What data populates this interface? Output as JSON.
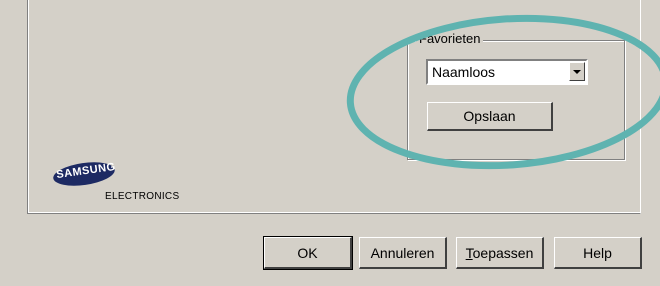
{
  "favorites": {
    "legend": "Favorieten",
    "selected_value": "Naamloos",
    "save_label": "Opslaan"
  },
  "logo": {
    "brand": "SAMSUNG",
    "subtitle": "ELECTRONICS",
    "brand_color": "#1d2a63"
  },
  "footer": {
    "ok_label": "OK",
    "cancel_label": "Annuleren",
    "apply_label_rest": "oepassen",
    "apply_mnemonic": "T",
    "help_label": "Help"
  },
  "colors": {
    "dialog_bg": "#d4d0c8",
    "highlight": "#5fb3b0"
  }
}
